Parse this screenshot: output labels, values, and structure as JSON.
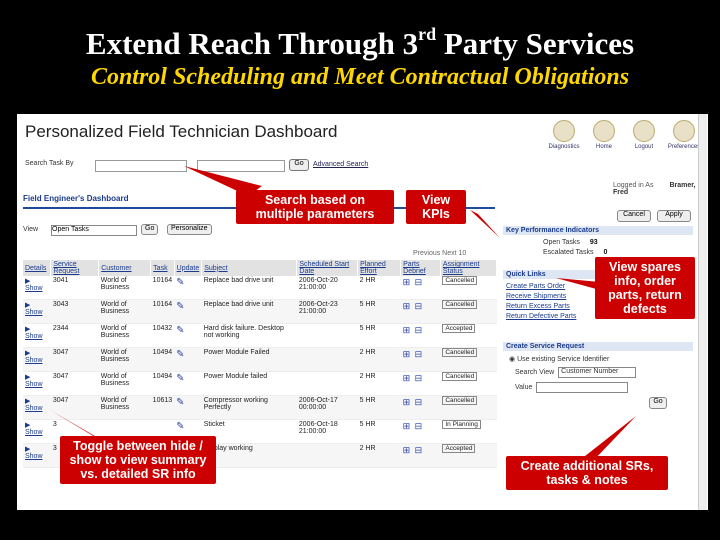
{
  "slide": {
    "title_main": "Extend Reach Through 3",
    "title_sup": "rd",
    "title_end": " Party Services",
    "subtitle": "Control Scheduling and Meet Contractual Obligations"
  },
  "dashboard": {
    "title": "Personalized Field Technician Dashboard",
    "toolbar": [
      "Diagnostics",
      "Home",
      "Logout",
      "Preferences"
    ],
    "search_label": "Search Task By",
    "go_label": "Go",
    "advanced_search": "Advanced Search",
    "logged_in_label": "Logged in As",
    "logged_in_user": "Bramer, Fred",
    "section_title": "Field Engineer's Dashboard",
    "view_label": "View",
    "view_value": "Open Tasks",
    "go2_label": "Go",
    "personalize_label": "Personalize",
    "prev_next": "Previous  Next 10",
    "cancel_label": "Cancel",
    "apply_label": "Apply",
    "columns": [
      "Details",
      "Service Request",
      "Customer",
      "Task",
      "Update",
      "Subject",
      "Scheduled Start Date",
      "Planned Effort",
      "Parts Debrief",
      "Assignment Status"
    ],
    "show_label": "Show",
    "rows": [
      {
        "sr": "3041",
        "customer": "World of Business",
        "task": "10164",
        "subject": "Replace bad drive unit",
        "date": "2006-Oct-20 21:00:00",
        "effort": "2 HR",
        "status": "Cancelled"
      },
      {
        "sr": "3043",
        "customer": "World of Business",
        "task": "10164",
        "subject": "Replace bad drive unit",
        "date": "2006-Oct-23 21:00:00",
        "effort": "5 HR",
        "status": "Cancelled"
      },
      {
        "sr": "2344",
        "customer": "World of Business",
        "task": "10432",
        "subject": "Hard disk failure. Desktop not working",
        "date": "",
        "effort": "5 HR",
        "status": "Accepted"
      },
      {
        "sr": "3047",
        "customer": "World of Business",
        "task": "10494",
        "subject": "Power Module Failed",
        "date": "",
        "effort": "2 HR",
        "status": "Cancelled"
      },
      {
        "sr": "3047",
        "customer": "World of Business",
        "task": "10494",
        "subject": "Power Module failed",
        "date": "",
        "effort": "2 HR",
        "status": "Cancelled"
      },
      {
        "sr": "3047",
        "customer": "World of Business",
        "task": "10613",
        "subject": "Compressor working Perfectly",
        "date": "2006-Oct-17 00:00:00",
        "effort": "5 HR",
        "status": "Cancelled"
      },
      {
        "sr": "3",
        "customer": "",
        "task": "",
        "subject": "Sticket",
        "date": "2006-Oct-18 21:00:00",
        "effort": "5 HR",
        "status": "In Planning"
      },
      {
        "sr": "3",
        "customer": "",
        "task": "",
        "subject": "Display working",
        "date": "",
        "effort": "2 HR",
        "status": "Accepted"
      }
    ],
    "kpi_title": "Key Performance Indicators",
    "kpis": [
      {
        "label": "Open Tasks",
        "value": "93"
      },
      {
        "label": "Escalated Tasks",
        "value": "0"
      }
    ],
    "quick_links_title": "Quick Links",
    "quick_links": [
      "Create Parts Order",
      "Receive Shipments",
      "Return Excess Parts",
      "Return Defective Parts"
    ],
    "csr_title": "Create Service Request",
    "csr_radio": "Use existing Service Identifier",
    "csr_search_label": "Search View",
    "csr_search_value": "Customer Number",
    "csr_value_label": "Value",
    "csr_go": "Go"
  },
  "callouts": {
    "search": "Search based on multiple parameters",
    "kpi": "View KPIs",
    "spares": "View spares info, order parts, return defects",
    "toggle": "Toggle between hide / show to view summary vs. detailed SR info",
    "create": "Create additional SRs, tasks & notes"
  },
  "colors": {
    "background": "#000000",
    "title": "#ffffff",
    "subtitle": "#ffd700",
    "callout": "#cc0000",
    "link": "#1a3b8e"
  }
}
